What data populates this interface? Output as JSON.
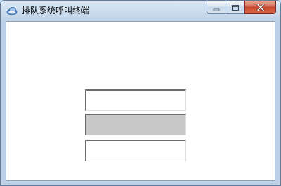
{
  "window": {
    "title": "排队系统呼叫终端",
    "icon": "app-cloud-icon",
    "caption": {
      "minimize_icon": "minimize-icon",
      "maximize_icon": "maximize-icon",
      "close_icon": "close-icon"
    }
  },
  "form": {
    "field_1": {
      "value": "",
      "placeholder": ""
    },
    "field_2": {
      "value": "",
      "placeholder": "",
      "background": "#c8c8c8"
    },
    "field_3": {
      "value": "",
      "placeholder": ""
    }
  },
  "colors": {
    "close_button": "#c7442b",
    "client_background": "#ffffff",
    "frame": "#c9dcef"
  }
}
